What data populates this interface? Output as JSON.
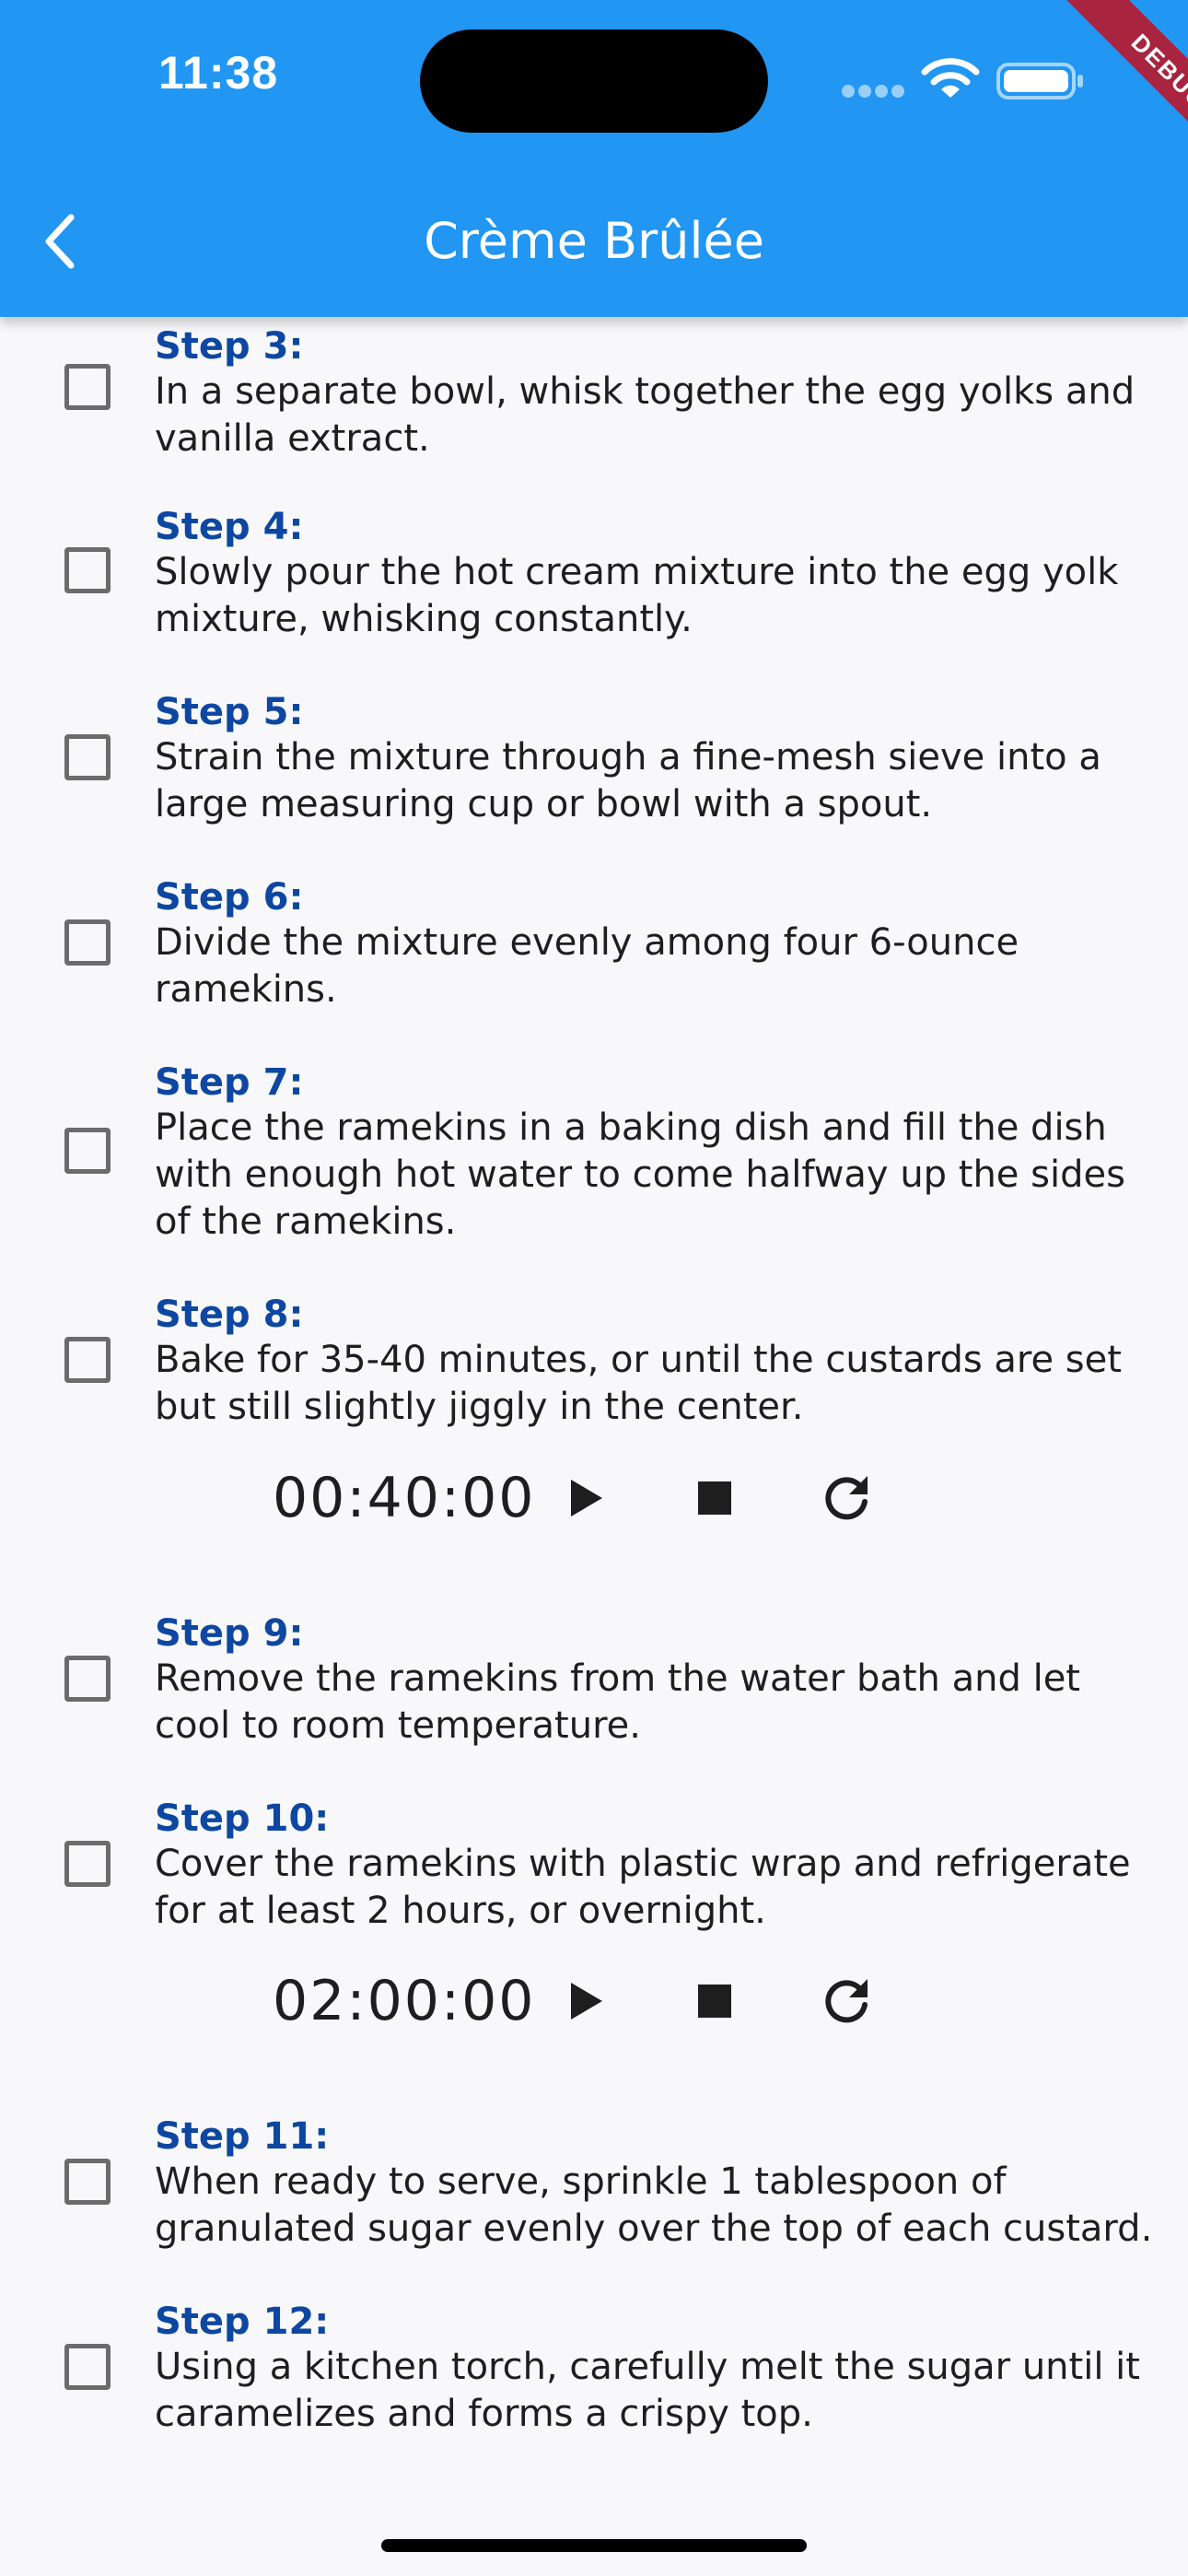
{
  "status_bar": {
    "time": "11:38"
  },
  "debug_banner": "DEBUG",
  "app_bar": {
    "title": "Crème Brûlée",
    "back_icon": "chevron-left-icon"
  },
  "steps": [
    {
      "label": "Step 3:",
      "text": "In a separate bowl, whisk together the egg yolks and vanilla extract.",
      "checked": false
    },
    {
      "label": "Step 4:",
      "text": "Slowly pour the hot cream mixture into the egg yolk mixture, whisking constantly.",
      "checked": false
    },
    {
      "label": "Step 5:",
      "text": "Strain the mixture through a fine-mesh sieve into a large measuring cup or bowl with a spout.",
      "checked": false
    },
    {
      "label": "Step 6:",
      "text": "Divide the mixture evenly among four 6-ounce ramekins.",
      "checked": false
    },
    {
      "label": "Step 7:",
      "text": "Place the ramekins in a baking dish and fill the dish with enough hot water to come halfway up the sides of the ramekins.",
      "checked": false
    },
    {
      "label": "Step 8:",
      "text": "Bake for 35-40 minutes, or until the custards are set but still slightly jiggly in the center.",
      "checked": false
    },
    {
      "label": "Step 9:",
      "text": "Remove the ramekins from the water bath and let cool to room temperature.",
      "checked": false
    },
    {
      "label": "Step 10:",
      "text": "Cover the ramekins with plastic wrap and refrigerate for at least 2 hours, or overnight.",
      "checked": false
    },
    {
      "label": "Step 11:",
      "text": "When ready to serve, sprinkle 1 tablespoon of granulated sugar evenly over the top of each custard.",
      "checked": false
    },
    {
      "label": "Step 12:",
      "text": "Using a kitchen torch, carefully melt the sugar until it caramelizes and forms a crispy top.",
      "checked": false
    }
  ],
  "timers": [
    {
      "step": "Step 8:",
      "time": "00:40:00",
      "icons": [
        "play-icon",
        "stop-icon",
        "refresh-icon"
      ]
    },
    {
      "step": "Step 10:",
      "time": "02:00:00",
      "icons": [
        "play-icon",
        "stop-icon",
        "refresh-icon"
      ]
    }
  ],
  "colors": {
    "app_bar": "#2196f3",
    "step_label": "#0d47a1",
    "debug_ribbon": "#a8243f",
    "background": "#f8f8fa"
  }
}
